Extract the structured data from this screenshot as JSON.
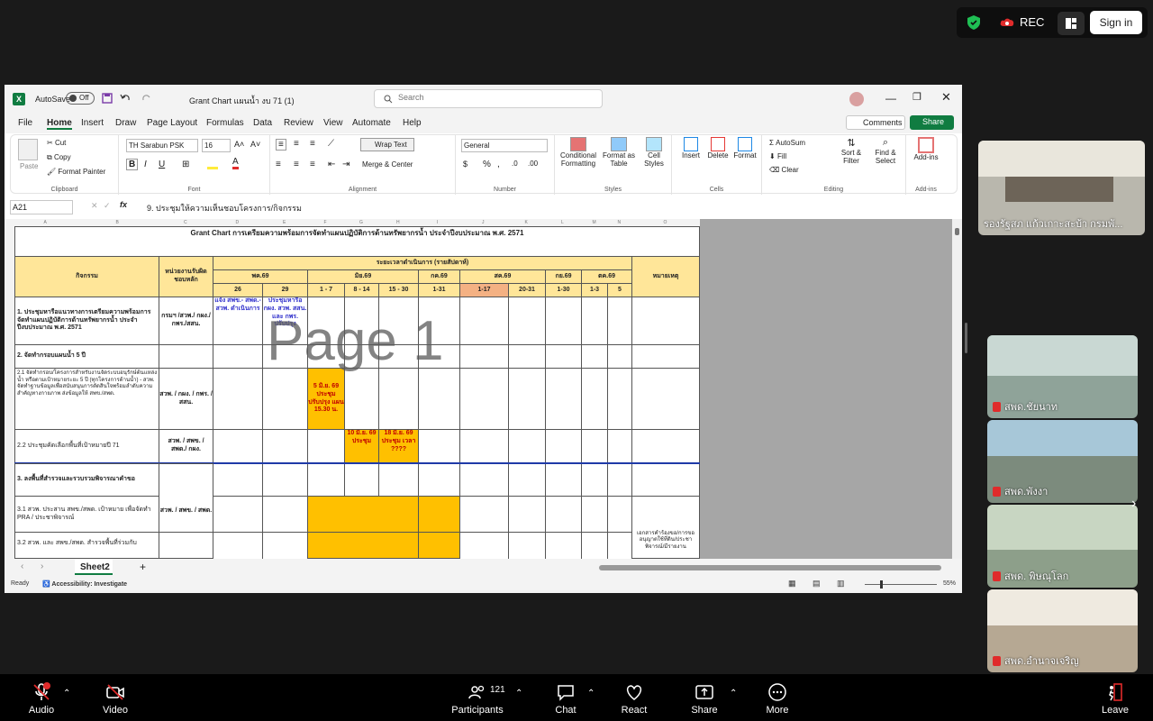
{
  "topbar": {
    "rec_label": "REC",
    "signin_label": "Sign in"
  },
  "excel": {
    "autosave_label": "AutoSave",
    "autosave_state": "Off",
    "file_title": "Grant Chart แผนน้ำ งบ 71 (1)",
    "search_placeholder": "Search",
    "menu": [
      "File",
      "Home",
      "Insert",
      "Draw",
      "Page Layout",
      "Formulas",
      "Data",
      "Review",
      "View",
      "Automate",
      "Help"
    ],
    "comments_label": "Comments",
    "share_label": "Share",
    "ribbon": {
      "paste": "Paste",
      "cut": "Cut",
      "copy": "Copy",
      "format_painter": "Format Painter",
      "clipboard": "Clipboard",
      "font_name": "TH Sarabun PSK",
      "font_size": "16",
      "font": "Font",
      "wrap_text": "Wrap Text",
      "merge_center": "Merge & Center",
      "alignment": "Alignment",
      "number_format": "General",
      "number": "Number",
      "conditional_formatting": "Conditional Formatting",
      "format_as_table": "Format as Table",
      "cell_styles": "Cell Styles",
      "styles": "Styles",
      "insert": "Insert",
      "delete": "Delete",
      "format": "Format",
      "cells": "Cells",
      "autosum": "AutoSum",
      "fill": "Fill",
      "clear": "Clear",
      "sort_filter": "Sort & Filter",
      "find_select": "Find & Select",
      "editing": "Editing",
      "addins": "Add-ins",
      "addins_group": "Add-ins"
    },
    "name_box": "A21",
    "formula": "9. ประชุมให้ความเห็นชอบโครงการ/กิจกรรม",
    "columns": [
      "A",
      "B",
      "C",
      "D",
      "E",
      "F",
      "G",
      "H",
      "I",
      "J",
      "K",
      "L",
      "M",
      "N",
      "O",
      "P",
      "Q",
      "R",
      "S",
      "T",
      "U",
      "V",
      "W"
    ],
    "sheet": {
      "title": "Grant Chart การเตรียมความพร้อมการจัดทำแผนปฏิบัติการด้านทรัพยากรน้ำ ประจำปีงบประมาณ พ.ศ. 2571",
      "watermark": "Page 1",
      "h_activity": "กิจกรรม",
      "h_agency": "หน่วยงานรับผิดชอบหลัก",
      "h_period": "ระยะเวลาดำเนินการ (รายสัปดาห์)",
      "h_note": "หมายเหตุ",
      "months": [
        "พค.69",
        "มิย.69",
        "กค.69",
        "สค.69",
        "กย.69",
        "ตค.69"
      ],
      "weeks": [
        "26",
        "29",
        "1 - 7",
        "8 - 14",
        "15 - 30",
        "1-31",
        "1-17",
        "20-31",
        "1-30",
        "1-3",
        "5"
      ],
      "r1_activity": "1. ประชุมหารือแนวทางการเตรียมความพร้อมการจัดทำแผนปฏิบัติการด้านทรัพยากรน้ำ ประจำปีงบประมาณ พ.ศ. 2571",
      "r1_agency": "กรมฯ /สวพ./ กผง./กพร./สสน.",
      "r1_c1": "แจ้ง สพข.- สพด.-สวพ. ดำเนินการ",
      "r1_c2": "ประชุมหารือ กผง. สวพ. สสน. และ กพร. ปรับปรุง",
      "r2_activity": "2. จัดทำกรอบแผนน้ำ 5 ปี",
      "r3_activity": "2.1 จัดทำกรอบ/โครงการสำหรับงานจัดระบบอนุรักษ์ต้นแหล่งน้ำ หรือตามเป้าหมายระยะ 5 ปี (ทุกโครงการด้านน้ำ) - สวพ. จัดทำฐานข้อมูลเพื่อสนับสนุนการตัดสินใจพร้อมลำดับความสำคัญทางกายภาพ ส่งข้อมูลให้ สพข./สพด.",
      "r3_agency": "สวพ. / กผง. / กพร. / สสน.",
      "r3_c1": "5 มิ.ย. 69 ประชุม ปรับปรุง แผน 15.30 น.",
      "r4_activity": "2.2 ประชุมคัดเลือกพื้นที่เป้าหมายปี 71",
      "r4_agency": "สวพ. / สพข. / สพด./ กผง.",
      "r4_c1": "10 มิ.ย. 69 ประชุม",
      "r4_c2": "18 มิ.ย. 69 ประชุม เวลา ????",
      "r5_activity": "3. ลงพื้นที่สำรวจและรวบรวมพิจารณาคำขอ",
      "r6_activity": "3.1 สวพ. ประสาน สพข./สพด. เป้าหมาย เพื่อจัดทำ PRA / ประชาพิจารณ์",
      "r6_agency": "สวพ. / สพข. / สพด.",
      "r7_activity": "3.2 สวพ. และ สพข./สพด. สำรวจพื้นที่ร่วมกับ",
      "r7_note": "เอกสารคำร้องขอ/การขออนุญาตใช้ที่ดิน/ประชาพิจารณ์/มีรายงาน"
    },
    "sheet_tab": "Sheet2",
    "status_ready": "Ready",
    "status_accessibility": "Accessibility: Investigate",
    "zoom": "55%"
  },
  "participants": [
    {
      "name": "รองรัฐสภ แก้วเกาะสะบ้า กรมพั..."
    },
    {
      "name": "สพด.ชัยนาท"
    },
    {
      "name": "สพด.พังงา"
    },
    {
      "name": "สพด. พิษณุโลก"
    },
    {
      "name": "สพด.อำนาจเจริญ"
    }
  ],
  "bottombar": {
    "audio": "Audio",
    "video": "Video",
    "participants": "Participants",
    "participants_count": "121",
    "chat": "Chat",
    "react": "React",
    "share": "Share",
    "more": "More",
    "leave": "Leave"
  },
  "colors": {
    "excel_green": "#107c41",
    "highlight_orange": "#ffc000",
    "header_yellow": "#ffe699",
    "salmon": "#f4b183",
    "leave_red": "#e02b2b"
  }
}
